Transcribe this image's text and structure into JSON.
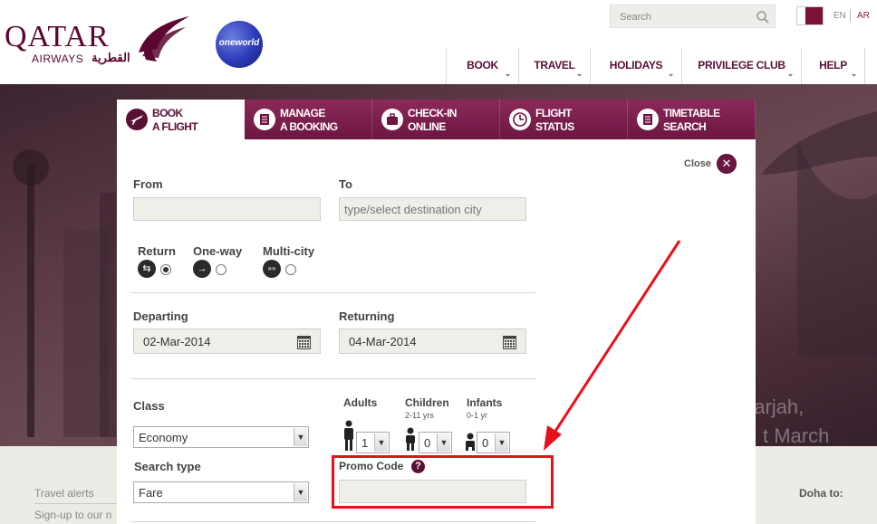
{
  "header": {
    "logo_text": "QATAR",
    "logo_sub": "AIRWAYS",
    "logo_arabic": "القطرية",
    "oneworld": "oneworld",
    "search_placeholder": "Search",
    "lang_en": "EN",
    "lang_ar": "AR",
    "nav": [
      {
        "label": "BOOK"
      },
      {
        "label": "TRAVEL"
      },
      {
        "label": "HOLIDAYS"
      },
      {
        "label": "PRIVILEGE CLUB"
      },
      {
        "label": "HELP"
      }
    ]
  },
  "hero": {
    "line1": "harjah,",
    "line2": "t March"
  },
  "footer": {
    "travel_alerts": "Travel alerts",
    "signup": "Sign-up to our n",
    "doha_to": "Doha to:"
  },
  "tabs": [
    {
      "line1": "BOOK",
      "line2": "A FLIGHT",
      "icon": "plane-icon",
      "active": true
    },
    {
      "line1": "MANAGE",
      "line2": "A BOOKING",
      "icon": "list-icon",
      "active": false
    },
    {
      "line1": "CHECK-IN",
      "line2": "ONLINE",
      "icon": "briefcase-icon",
      "active": false
    },
    {
      "line1": "FLIGHT",
      "line2": "STATUS",
      "icon": "clock-icon",
      "active": false
    },
    {
      "line1": "TIMETABLE",
      "line2": "SEARCH",
      "icon": "list-icon",
      "active": false
    }
  ],
  "form": {
    "close_label": "Close",
    "close_glyph": "✕",
    "from_label": "From",
    "from_value": "",
    "to_label": "To",
    "to_placeholder": "type/select destination city",
    "trip_types": [
      {
        "label": "Return",
        "glyph": "⇆",
        "selected": true
      },
      {
        "label": "One-way",
        "glyph": "→",
        "selected": false
      },
      {
        "label": "Multi-city",
        "glyph": "»»",
        "selected": false
      }
    ],
    "departing_label": "Departing",
    "departing_value": "02-Mar-2014",
    "returning_label": "Returning",
    "returning_value": "04-Mar-2014",
    "class_label": "Class",
    "class_value": "Economy",
    "search_type_label": "Search type",
    "search_type_value": "Fare",
    "adults_label": "Adults",
    "adults_value": "1",
    "children_label": "Children",
    "children_sub": "2-11 yrs",
    "children_value": "0",
    "infants_label": "Infants",
    "infants_sub": "0-1 yr",
    "infants_value": "0",
    "promo_label": "Promo Code",
    "promo_help": "?",
    "promo_value": "",
    "dropdown_glyph": "▼"
  },
  "colors": {
    "brand": "#5a0f35",
    "highlight": "#e8101c"
  }
}
